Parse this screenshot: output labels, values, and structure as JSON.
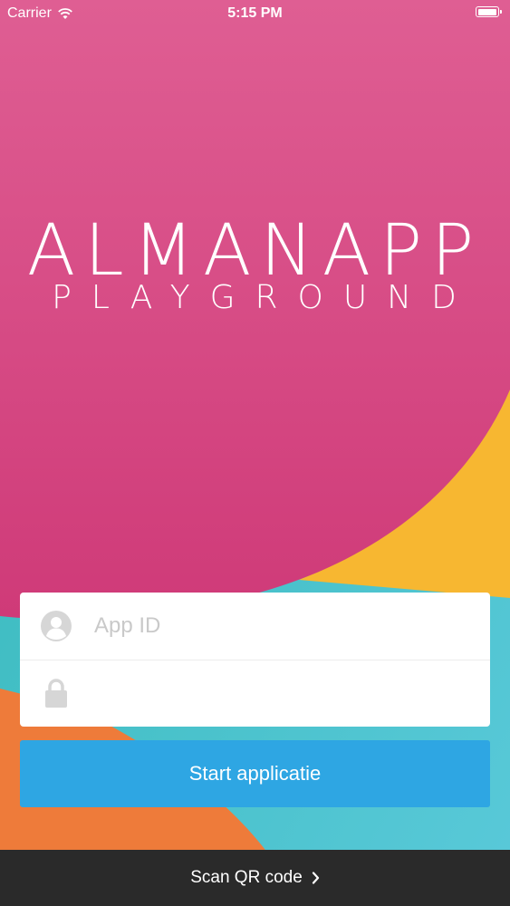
{
  "status_bar": {
    "carrier": "Carrier",
    "time": "5:15 PM",
    "icons": [
      "wifi-icon",
      "battery-icon"
    ]
  },
  "logo": {
    "title": "ALMANAPP",
    "subtitle": "PLAYGROUND"
  },
  "login_form": {
    "app_id": {
      "placeholder": "App ID",
      "value": "",
      "icon": "user-icon"
    },
    "password": {
      "placeholder": "",
      "value": "",
      "icon": "lock-icon"
    }
  },
  "start_button": {
    "label": "Start applicatie"
  },
  "bottom_bar": {
    "label": "Scan QR code",
    "icon": "chevron-right-icon"
  },
  "colors": {
    "pink": "#d7437f",
    "yellow": "#f7b731",
    "teal": "#3bbfc4",
    "orange": "#ef7a3a",
    "button": "#2ea6e3",
    "bottom_bar": "#2a2a2a"
  }
}
